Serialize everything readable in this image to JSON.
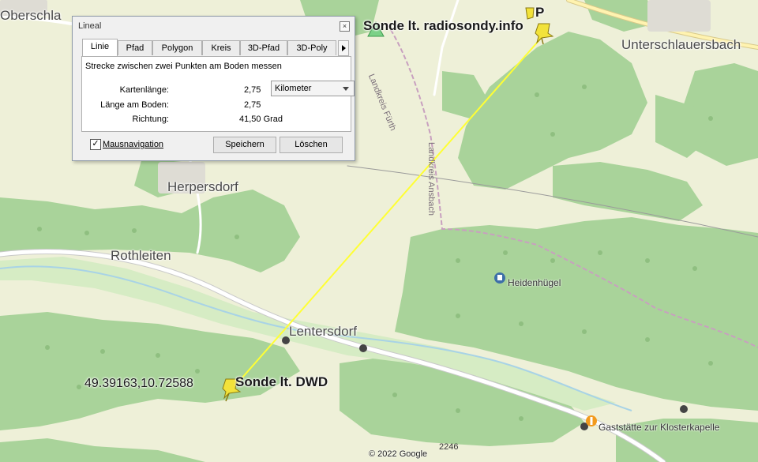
{
  "map": {
    "places": {
      "oberschlauersbach": "Oberschla",
      "unterschlauersbach": "Unterschlauersbach",
      "herpersdorf": "Herpersdorf",
      "rothleiten": "Rothleiten",
      "lentersdorf": "Lentersdorf"
    },
    "markers": {
      "sonde_radiosondy": "Sonde lt. radiosondy.info",
      "sonde_radiosondy_suffix": "P",
      "sonde_dwd": "Sonde lt. DWD",
      "coords": "49.39163,10.72588"
    },
    "boundaries": {
      "landkreis_fuerth": "Landkreis Fürth",
      "landkreis_ansbach": "Landkreis Ansbach"
    },
    "pois": {
      "heidenhuegel": "Heidenhügel",
      "gaststaette": "Gaststätte zur Klosterkapelle"
    },
    "road_number": "2246",
    "copyright": "© 2022 Google",
    "colors": {
      "forest": "#a9d39a",
      "meadow": "#eef0d8",
      "measure_line": "#ffff33",
      "pin": "#f2e23a"
    }
  },
  "dialog": {
    "title": "Lineal",
    "tabs": [
      "Linie",
      "Pfad",
      "Polygon",
      "Kreis",
      "3D-Pfad",
      "3D-Poly"
    ],
    "active_tab": "Linie",
    "description": "Strecke zwischen zwei Punkten am Boden messen",
    "fields": {
      "map_length_label": "Kartenlänge:",
      "map_length_value": "2,75",
      "ground_length_label": "Länge am Boden:",
      "ground_length_value": "2,75",
      "direction_label": "Richtung:",
      "direction_value": "41,50 Grad"
    },
    "unit": "Kilometer",
    "mouse_nav_label": "Mausnavigation",
    "mouse_nav_checked": "✓",
    "save_label": "Speichern",
    "delete_label": "Löschen"
  }
}
